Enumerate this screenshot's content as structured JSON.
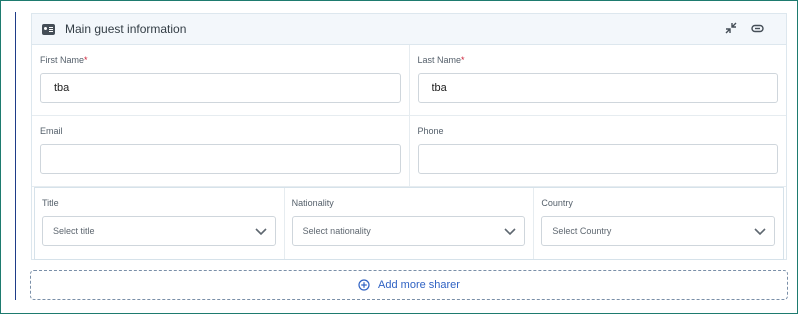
{
  "guest_card": {
    "title": "Main guest information",
    "header_icon": "id-card-icon",
    "actions": [
      "collapse-arrows-icon",
      "link-icon"
    ]
  },
  "fields": {
    "first_name": {
      "label": "First Name",
      "required_mark": "*",
      "value": "tba"
    },
    "last_name": {
      "label": "Last Name",
      "required_mark": "*",
      "value": "tba"
    },
    "email": {
      "label": "Email",
      "value": ""
    },
    "phone": {
      "label": "Phone",
      "value": ""
    },
    "title": {
      "label": "Title",
      "placeholder": "Select title"
    },
    "nationality": {
      "label": "Nationality",
      "placeholder": "Select nationality"
    },
    "country": {
      "label": "Country",
      "placeholder": "Select Country"
    }
  },
  "add_sharer": {
    "label": "Add more sharer",
    "icon": "plus-circle-icon"
  },
  "colors": {
    "accent": "#2f62c3",
    "required": "#cc1f36",
    "frame": "#1e7b6f"
  }
}
